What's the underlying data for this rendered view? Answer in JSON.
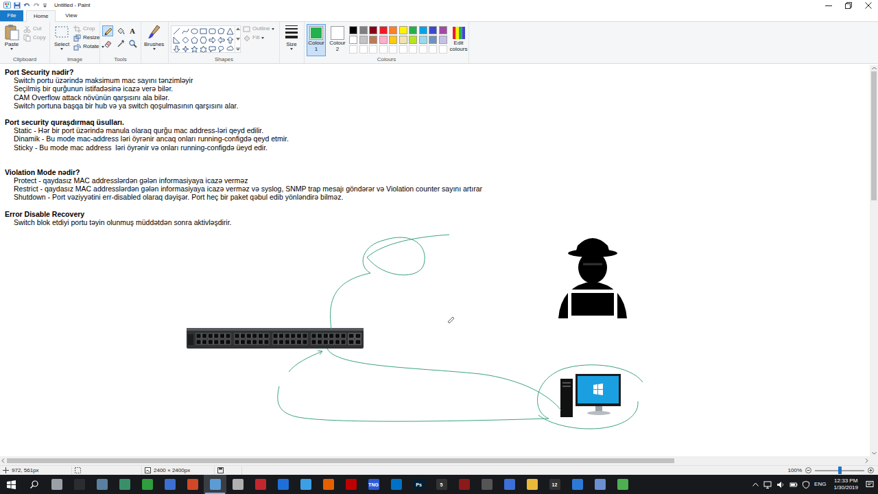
{
  "window": {
    "title": "Untitled - Paint"
  },
  "file_menu": {
    "label": "File"
  },
  "ribbon_tabs": [
    {
      "label": "Home",
      "selected": true
    },
    {
      "label": "View",
      "selected": false
    }
  ],
  "clipboard": {
    "label": "Clipboard",
    "paste": "Paste",
    "cut": {
      "label": "Cut",
      "disabled": true
    },
    "copy": {
      "label": "Copy",
      "disabled": true
    }
  },
  "image": {
    "label": "Image",
    "select": "Select",
    "crop": {
      "label": "Crop",
      "disabled": true
    },
    "resize": {
      "label": "Resize",
      "disabled": false
    },
    "rotate": {
      "label": "Rotate",
      "disabled": false
    }
  },
  "tools": {
    "label": "Tools",
    "items": [
      {
        "kind": "pencil",
        "selected": true
      },
      {
        "kind": "fill",
        "selected": false
      },
      {
        "kind": "text",
        "glyph": "A",
        "selected": false
      },
      {
        "kind": "eraser",
        "selected": false
      },
      {
        "kind": "picker",
        "selected": false
      },
      {
        "kind": "magnifier",
        "selected": false
      }
    ]
  },
  "brushes": {
    "label": "Brushes"
  },
  "shapes": {
    "label": "Shapes",
    "outline": {
      "label": "Outline",
      "disabled": true
    },
    "fill": {
      "label": "Fill",
      "disabled": true
    }
  },
  "size": {
    "label": "Size"
  },
  "colour1": {
    "label": "Colour 1",
    "color": "#22b14c",
    "selected": true
  },
  "colour2": {
    "label": "Colour 2",
    "color": "#ffffff",
    "selected": false
  },
  "palette": {
    "label": "Colours",
    "edit": "Edit colours",
    "colors": [
      {
        "color": "#000000"
      },
      {
        "color": "#7f7f7f"
      },
      {
        "color": "#880015"
      },
      {
        "color": "#ed1c24"
      },
      {
        "color": "#ff7f27"
      },
      {
        "color": "#fff200"
      },
      {
        "color": "#22b14c"
      },
      {
        "color": "#00a2e8"
      },
      {
        "color": "#3f48cc"
      },
      {
        "color": "#a349a4"
      },
      {
        "color": "#ffffff"
      },
      {
        "color": "#c3c3c3"
      },
      {
        "color": "#b97a57"
      },
      {
        "color": "#ffaec9"
      },
      {
        "color": "#ffc90e"
      },
      {
        "color": "#efe4b0"
      },
      {
        "color": "#b5e61d"
      },
      {
        "color": "#99d9ea"
      },
      {
        "color": "#7092be"
      },
      {
        "color": "#c8bfe7"
      },
      {
        "color": "#ffffff",
        "empty": true
      },
      {
        "color": "#ffffff",
        "empty": true
      },
      {
        "color": "#ffffff",
        "empty": true
      },
      {
        "color": "#ffffff",
        "empty": true
      },
      {
        "color": "#ffffff",
        "empty": true
      },
      {
        "color": "#ffffff",
        "empty": true
      },
      {
        "color": "#ffffff",
        "empty": true
      },
      {
        "color": "#ffffff",
        "empty": true
      },
      {
        "color": "#ffffff",
        "empty": true
      },
      {
        "color": "#ffffff",
        "empty": true
      }
    ]
  },
  "canvas": {
    "sections": [
      {
        "heading": "Port Security nədir?",
        "lines": [
          "Switch portu üzərində maksimum mac sayını tənzimləyir",
          "Seçilmiş bir qurğunun istifadəsinə icazə verə bilər.",
          "CAM Overflow attack növünün qarşısını ala bilər.",
          "Switch portuna başqa bir hub və ya switch qoşulmasının qarşısını alar."
        ]
      },
      {
        "heading": "Port security quraşdırmaq üsulları.",
        "lines": [
          "Static - Hər bir port üzərində manula olaraq qurğu mac address-ləri qeyd edilir.",
          "Dinamik - Bu mode mac-address ləri öyrənir ancaq onları running-configdə qeyd etmir.",
          "Sticky - Bu mode mac address  ləri öyrənir və onları running-configdə üeyd edir."
        ]
      },
      {
        "heading": "Violation Mode nədir?",
        "lines": [
          "Protect - qaydasız MAC addresslərdən gələn informasiyaya icazə verməz",
          "Restrict - qaydasız MAC addresslərdən gələn informasiyaya icazə verməz və syslog, SNMP trap mesajı göndərər və Violation counter sayını artırar",
          "Shutdown - Port vəziyyətini err-disabled olaraq dəyişər. Port heç bir paket qəbul edib yönləndirə bilməz."
        ]
      },
      {
        "heading": "Error Disable Recovery",
        "lines": [
          "Switch blok etdiyi portu təyin olunmuş müddətdən sonra aktivləşdirir."
        ]
      }
    ],
    "v_scroll_level": 0.34,
    "h_scroll_level": 0.78
  },
  "status_bar": {
    "cursor": "972, 561px",
    "size": "2400 × 2400px",
    "zoom": "100%",
    "zoom_level": 0.5
  },
  "taskbar": {
    "apps": [
      {
        "color": "#9aa0a6",
        "selected": false
      },
      {
        "color": "#2d2d30",
        "selected": false
      },
      {
        "color": "#5a7fa0",
        "selected": false
      },
      {
        "color": "#3a8f6b",
        "selected": false
      },
      {
        "color": "#2e9e3e",
        "selected": false
      },
      {
        "color": "#3c6fd1",
        "selected": false
      },
      {
        "color": "#d24726",
        "selected": false
      },
      {
        "color": "#5c9bd5",
        "selected": true
      },
      {
        "color": "#b0b0b0",
        "selected": false
      },
      {
        "color": "#c1272d",
        "selected": false
      },
      {
        "color": "#1e6fd9",
        "selected": false
      },
      {
        "color": "#3c9ee5",
        "selected": false
      },
      {
        "color": "#e66000",
        "selected": false
      },
      {
        "color": "#bf0000",
        "selected": false
      },
      {
        "color": "#2a5bd7",
        "glyph": "TNG",
        "selected": false
      },
      {
        "color": "#0072c6",
        "selected": false
      },
      {
        "color": "#001e36",
        "glyph": "Ps",
        "selected": false
      },
      {
        "color": "#333333",
        "glyph": "5",
        "selected": false
      },
      {
        "color": "#8b1a1a",
        "selected": false
      },
      {
        "color": "#555555",
        "selected": false
      },
      {
        "color": "#3d6fd8",
        "selected": false
      },
      {
        "color": "#e8b93a",
        "selected": false
      },
      {
        "color": "#333333",
        "glyph": "12",
        "selected": false
      },
      {
        "color": "#2c7ad6",
        "selected": false
      },
      {
        "color": "#6b8fd0",
        "selected": false
      },
      {
        "color": "#4caf50",
        "selected": false
      }
    ],
    "language": "ENG",
    "time": "12:33 PM",
    "date": "1/30/2019"
  }
}
